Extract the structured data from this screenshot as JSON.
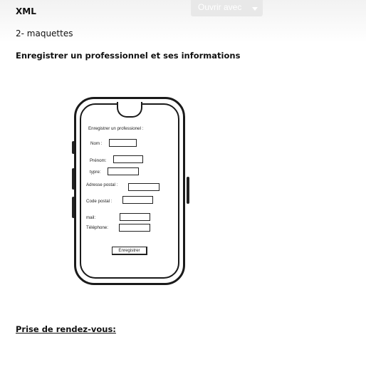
{
  "document": {
    "title": "XML",
    "line1": "2- maquettes",
    "line2": "Enregistrer un professionnel et ses informations",
    "section_heading": "Prise de rendez-vous:"
  },
  "toolbar": {
    "open_with_label": "Ouvrir avec"
  },
  "mockup": {
    "form_title": "Enregistrer un professionel :",
    "fields": [
      {
        "label": "Nom :"
      },
      {
        "label": "Prénom:"
      },
      {
        "label": "typre:"
      },
      {
        "label": "Adresse postal :"
      },
      {
        "label": "Code  postal :"
      },
      {
        "label": "mail:"
      },
      {
        "label": "Téléphone:"
      }
    ],
    "submit_label": "Enregistrer"
  },
  "colors": {
    "background": "#ffffff",
    "button_bg": "#e8e8e8",
    "button_text": "#ffffff",
    "ink": "#1a1a1a"
  }
}
